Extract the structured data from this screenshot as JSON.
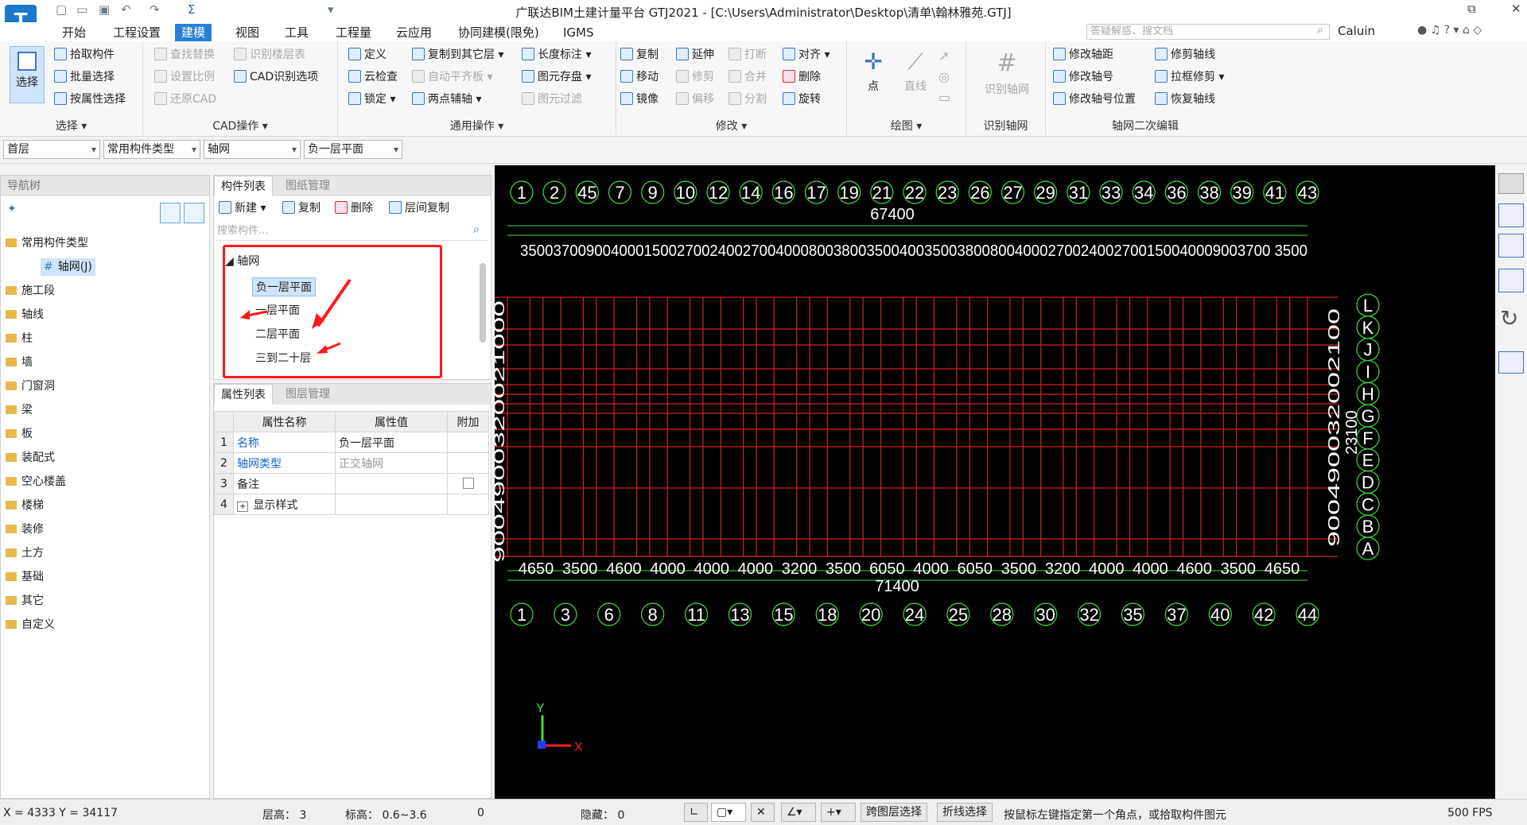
{
  "app": {
    "title": "广联达BIM土建计量平台 GTJ2021 - [C:\\Users\\Administrator\\Desktop\\清单\\翰林雅苑.GTJ]",
    "logo": "T"
  },
  "menu": [
    "开始",
    "工程设置",
    "建模",
    "视图",
    "工具",
    "工程量",
    "云应用",
    "协同建模(限免)",
    "IGMS"
  ],
  "menu_active": "建模",
  "search_placeholder": "答疑解惑、搜文档",
  "user": "Caluin",
  "ribbon": {
    "select": {
      "big": "选择",
      "items": [
        "拾取构件",
        "批量选择",
        "按属性选择"
      ],
      "label": "选择 ▾"
    },
    "cad": {
      "items": [
        "查找替换",
        "设置比例",
        "还原CAD",
        "识别楼层表",
        "CAD识别选项"
      ],
      "label": "CAD操作 ▾"
    },
    "general": {
      "items": [
        "定义",
        "云检查",
        "锁定 ▾",
        "复制到其它层 ▾",
        "自动平齐板 ▾",
        "两点辅轴 ▾",
        "长度标注 ▾",
        "图元存盘 ▾",
        "图元过滤"
      ],
      "label": "通用操作 ▾"
    },
    "modify": {
      "items": [
        "复制",
        "移动",
        "镜像",
        "延伸",
        "修剪",
        "偏移",
        "打断",
        "合并",
        "分割",
        "对齐 ▾",
        "删除",
        "旋转"
      ],
      "label": "修改 ▾"
    },
    "draw": {
      "items": [
        "点",
        "直线"
      ],
      "label": "绘图 ▾"
    },
    "recog": {
      "items": [
        "识别轴网"
      ],
      "label": "识别轴网"
    },
    "axis2": {
      "items": [
        "修改轴距",
        "修改轴号",
        "修改轴号位置",
        "修剪轴线",
        "拉框修剪 ▾",
        "恢复轴线"
      ],
      "label": "轴网二次编辑"
    }
  },
  "combos": [
    "首层",
    "常用构件类型",
    "轴网",
    "负一层平面"
  ],
  "nav": {
    "title": "导航树",
    "items": [
      "常用构件类型",
      "轴网(J)",
      "施工段",
      "轴线",
      "柱",
      "墙",
      "门窗洞",
      "梁",
      "板",
      "装配式",
      "空心楼盖",
      "楼梯",
      "装修",
      "土方",
      "基础",
      "其它",
      "自定义"
    ]
  },
  "complist": {
    "tabs": [
      "构件列表",
      "图纸管理"
    ],
    "toolbar": [
      "新建 ▾",
      "复制",
      "删除",
      "层间复制"
    ],
    "search_placeholder": "搜索构件...",
    "root": "轴网",
    "items": [
      "负一层平面",
      "一层平面",
      "二层平面",
      "三到二十层"
    ],
    "selected": "负一层平面"
  },
  "props": {
    "tabs": [
      "属性列表",
      "图层管理"
    ],
    "headers": [
      "",
      "属性名称",
      "属性值",
      "附加"
    ],
    "rows": [
      [
        "1",
        "名称",
        "负一层平面",
        ""
      ],
      [
        "2",
        "轴网类型",
        "正交轴网",
        ""
      ],
      [
        "3",
        "备注",
        "",
        ""
      ],
      [
        "4",
        "显示样式",
        "",
        ""
      ]
    ]
  },
  "chart_data": {
    "type": "grid-drawing",
    "top_axis_numbers": [
      "1",
      "2",
      "45",
      "7",
      "9",
      "10",
      "12",
      "14",
      "16",
      "17",
      "19",
      "21",
      "22",
      "23",
      "26",
      "27",
      "29",
      "31",
      "33",
      "34",
      "36",
      "38",
      "39",
      "41",
      "43"
    ],
    "top_total": "67400",
    "top_dims": "3500370090040001500270024002700400080038003500400350038008004000270024002700150040009003700 3500",
    "bottom_axis_numbers": [
      "1",
      "3",
      "6",
      "8",
      "11",
      "13",
      "15",
      "18",
      "20",
      "24",
      "25",
      "28",
      "30",
      "32",
      "35",
      "37",
      "40",
      "42",
      "44"
    ],
    "bottom_dims": [
      "4650",
      "3500",
      "4600",
      "4000",
      "4000",
      "4000",
      "3200",
      "3500",
      "6050",
      "4000",
      "6050",
      "3500",
      "3200",
      "4000",
      "4000",
      "4600",
      "3500",
      "4650"
    ],
    "bottom_total": "71400",
    "right_axis_letters": [
      "L",
      "K",
      "J",
      "I",
      "H",
      "G",
      "F",
      "E",
      "D",
      "C",
      "B",
      "A"
    ],
    "right_total": "23100",
    "right_dims": "900490032002100",
    "left_dims": "9004900320021000",
    "ucs": [
      "Y",
      "X"
    ]
  },
  "status": {
    "coords": "X = 4333 Y = 34117",
    "floor_h": "层高： 3",
    "elev": "标高： 0.6~3.6",
    "zero": "0",
    "hidden": "隐藏： 0",
    "btn1": "跨图层选择",
    "btn2": "折线选择",
    "hint": "按鼠标左键指定第一个角点，或拾取构件图元",
    "fps": "500 FPS"
  },
  "colors": {
    "accent": "#2b7fd6",
    "grid_red": "#d6221f",
    "axis_green": "#3ce03c",
    "highlight": "#ff1a1a"
  }
}
